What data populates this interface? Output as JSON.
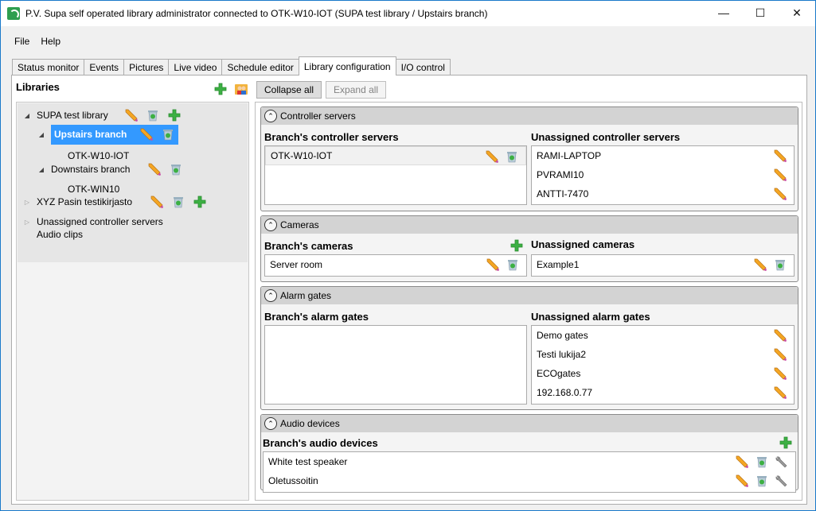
{
  "window": {
    "title": "P.V. Supa self operated library administrator connected to OTK-W10-IOT (SUPA test library / Upstairs branch)",
    "app_icon": "supa-app-icon",
    "controls": {
      "minimize": "—",
      "maximize": "☐",
      "close": "✕"
    }
  },
  "menu": {
    "items": [
      "File",
      "Help"
    ]
  },
  "tabs": [
    {
      "label": "Status monitor",
      "active": false
    },
    {
      "label": "Events",
      "active": false
    },
    {
      "label": "Pictures",
      "active": false
    },
    {
      "label": "Live video",
      "active": false
    },
    {
      "label": "Schedule editor",
      "active": false
    },
    {
      "label": "Library configuration",
      "active": true
    },
    {
      "label": "I/O control",
      "active": false
    }
  ],
  "libraries": {
    "title": "Libraries",
    "actions": [
      "add-icon",
      "user-groups-icon"
    ],
    "tree": [
      {
        "label": "SUPA test library",
        "level": 0,
        "expanded": true,
        "icons": [
          "pencil-icon",
          "recycle-bin-icon",
          "add-icon"
        ]
      },
      {
        "label": "Upstairs branch",
        "level": 1,
        "expanded": true,
        "selected": true,
        "icons": [
          "pencil-icon",
          "recycle-bin-icon"
        ]
      },
      {
        "label": "OTK-W10-IOT",
        "level": 2
      },
      {
        "label": "Downstairs branch",
        "level": 1,
        "expanded": true,
        "icons": [
          "pencil-icon",
          "recycle-bin-icon"
        ]
      },
      {
        "label": "OTK-WIN10",
        "level": 2
      },
      {
        "label": "XYZ Pasin testikirjasto",
        "level": 0,
        "expanded": false,
        "icons": [
          "pencil-icon",
          "recycle-bin-icon",
          "add-icon"
        ]
      },
      {
        "label": "Unassigned controller servers",
        "level": 0,
        "expanded": false
      },
      {
        "label": "Audio clips",
        "level": 0
      }
    ]
  },
  "toolbar": {
    "collapse_all": "Collapse all",
    "expand_all": "Expand all"
  },
  "sections": {
    "controller_servers": {
      "header": "Controller servers",
      "branch_title": "Branch's controller servers",
      "branch_items": [
        "OTK-W10-IOT"
      ],
      "unassigned_title": "Unassigned controller servers",
      "unassigned_items": [
        "RAMI-LAPTOP",
        "PVRAMI10",
        "ANTTI-7470"
      ]
    },
    "cameras": {
      "header": "Cameras",
      "branch_title": "Branch's cameras",
      "branch_items": [
        "Server room"
      ],
      "unassigned_title": "Unassigned cameras",
      "unassigned_items": [
        "Example1"
      ]
    },
    "alarm_gates": {
      "header": "Alarm gates",
      "branch_title": "Branch's alarm gates",
      "branch_items": [],
      "unassigned_title": "Unassigned alarm gates",
      "unassigned_items": [
        "Demo gates",
        "Testi lukija2",
        "ECOgates",
        "192.168.0.77"
      ]
    },
    "audio_devices": {
      "header": "Audio devices",
      "branch_title": "Branch's audio devices",
      "branch_items": [
        "White test speaker",
        "Oletussoitin"
      ]
    }
  },
  "colors": {
    "selection": "#3399ff",
    "section_header": "#d3d3d3",
    "add_green": "#3cb043",
    "window_border": "#1979ca"
  }
}
